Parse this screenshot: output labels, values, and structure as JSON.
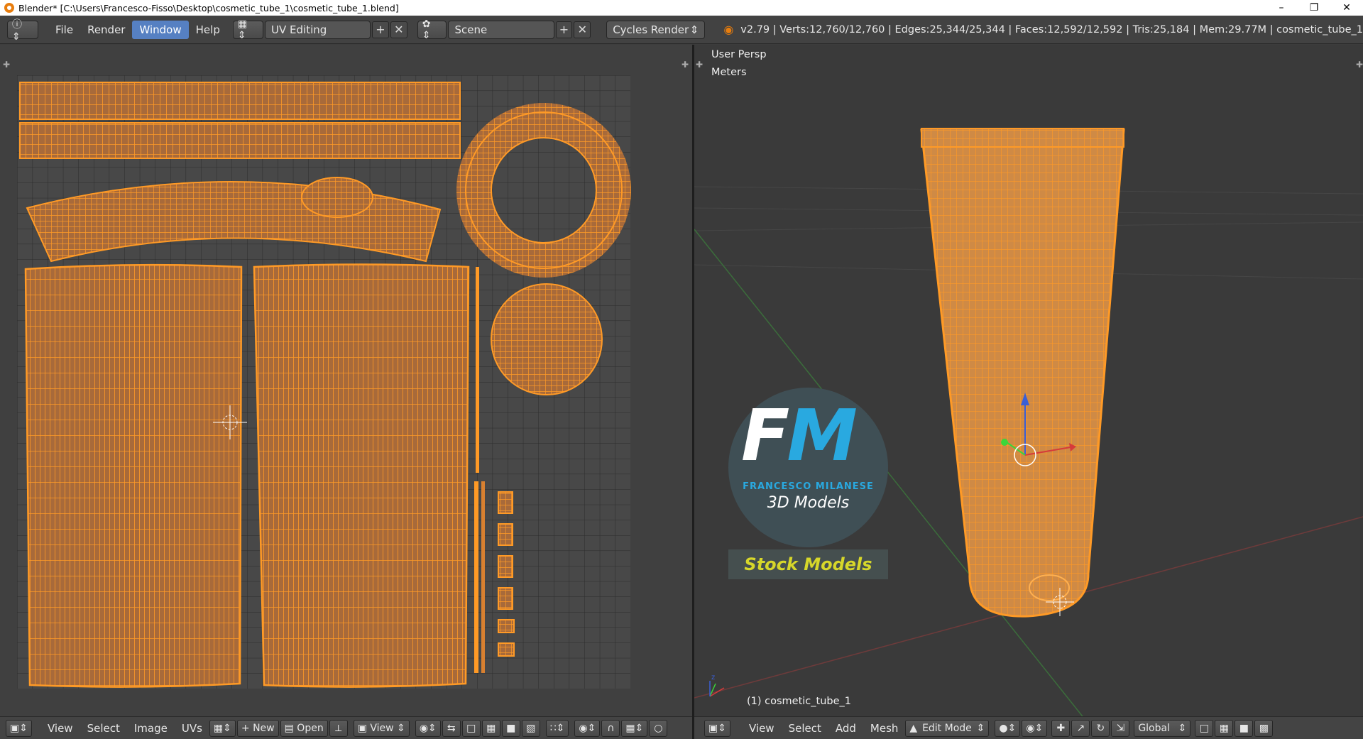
{
  "window": {
    "title": "Blender* [C:\\Users\\Francesco-Fisso\\Desktop\\cosmetic_tube_1\\cosmetic_tube_1.blend]",
    "minimize_icon": "minimize-icon",
    "restore_icon": "restore-icon",
    "close_icon": "close-icon"
  },
  "infobar": {
    "menus": [
      "File",
      "Render",
      "Window",
      "Help"
    ],
    "active_menu": "Window",
    "layout_name": "UV Editing",
    "scene_name": "Scene",
    "render_engine": "Cycles Render",
    "stats": "v2.79 | Verts:12,760/12,760 | Edges:25,344/25,344 | Faces:12,592/12,592 | Tris:25,184 | Mem:29.77M | cosmetic_tube_1"
  },
  "viewport": {
    "view_name": "User Persp",
    "units": "Meters",
    "object_label": "(1) cosmetic_tube_1"
  },
  "watermark": {
    "logo_letters": "FM",
    "brand": "FRANCESCO MILANESE",
    "line": "3D Models",
    "banner": "Stock Models"
  },
  "uv_bottombar": {
    "menus": [
      "View",
      "Select",
      "Image",
      "UVs"
    ],
    "new_label": "New",
    "open_label": "Open",
    "view_label": "View"
  },
  "viewport_bottombar": {
    "menus": [
      "View",
      "Select",
      "Add",
      "Mesh"
    ],
    "mode": "Edit Mode",
    "orientation": "Global"
  },
  "colors": {
    "wire": "#ff9a26",
    "face": "#c9773a",
    "accent": "#5680c2"
  }
}
